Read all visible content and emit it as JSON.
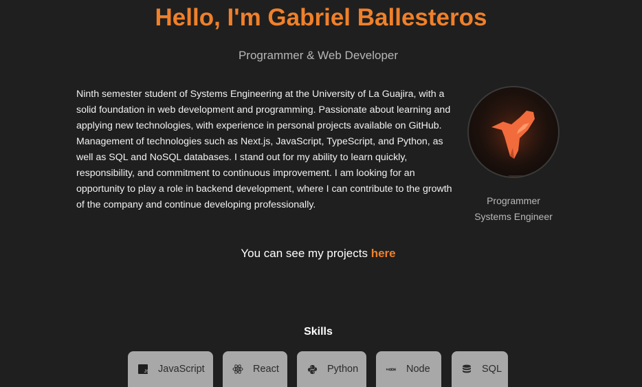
{
  "hero": {
    "title": "Hello, I'm Gabriel Ballesteros",
    "subtitle": "Programmer & Web Developer"
  },
  "bio": {
    "text": "Ninth semester student of Systems Engineering at the University of La Guajira, with a solid foundation in web development and programming. Passionate about learning and applying new technologies, with experience in personal projects available on GitHub. Management of technologies such as Next.js, JavaScript, TypeScript, and Python, as well as SQL and NoSQL databases. I stand out for my ability to learn quickly, responsibility, and commitment to continuous improvement. I am looking for an opportunity to play a role in backend development, where I can contribute to the growth of the company and continue developing professionally."
  },
  "profile": {
    "avatar_icon": "aorus-eagle-logo",
    "caption_line1": "Programmer",
    "caption_line2": "Systems Engineer"
  },
  "projects": {
    "prefix": "You can see my projects ",
    "link_label": "here"
  },
  "skills": {
    "heading": "Skills",
    "items": [
      {
        "label": "JavaScript",
        "icon": "javascript-icon"
      },
      {
        "label": "React",
        "icon": "react-icon"
      },
      {
        "label": "Python",
        "icon": "python-icon"
      },
      {
        "label": "Node",
        "icon": "nodejs-icon"
      },
      {
        "label": "SQL",
        "icon": "database-icon"
      }
    ]
  },
  "colors": {
    "accent": "#f0802a",
    "background": "#1f1f1f",
    "chip": "#a8a8a8"
  }
}
